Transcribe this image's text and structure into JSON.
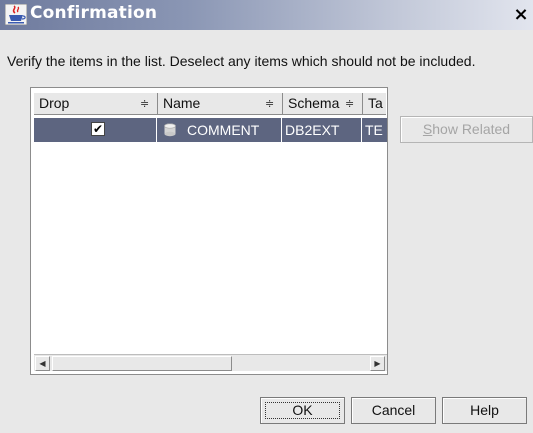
{
  "window": {
    "title": "Confirmation",
    "close_glyph": "×"
  },
  "instruction": "Verify the items in the list.  Deselect any items which should not be included.",
  "table": {
    "columns": [
      {
        "label": "Drop",
        "sort_icon": "sort-updown-icon"
      },
      {
        "label": "Name",
        "sort_icon": "sort-updown-icon"
      },
      {
        "label": "Schema",
        "sort_icon": "sort-updown-icon"
      },
      {
        "label": "Ta",
        "sort_icon": ""
      }
    ],
    "rows": [
      {
        "drop_checked": true,
        "name": "COMMENT",
        "schema": "DB2EXT",
        "type": "TE",
        "icon": "database-table-icon",
        "selected": true
      }
    ],
    "sort_glyph": "≑",
    "check_glyph": "✔"
  },
  "buttons": {
    "show_related_mnemonic": "S",
    "show_related_rest": "how Related",
    "ok": "OK",
    "cancel": "Cancel",
    "help": "Help"
  },
  "colors": {
    "selection": "#5d6580",
    "titlebar_start": "#6f7b9e"
  }
}
